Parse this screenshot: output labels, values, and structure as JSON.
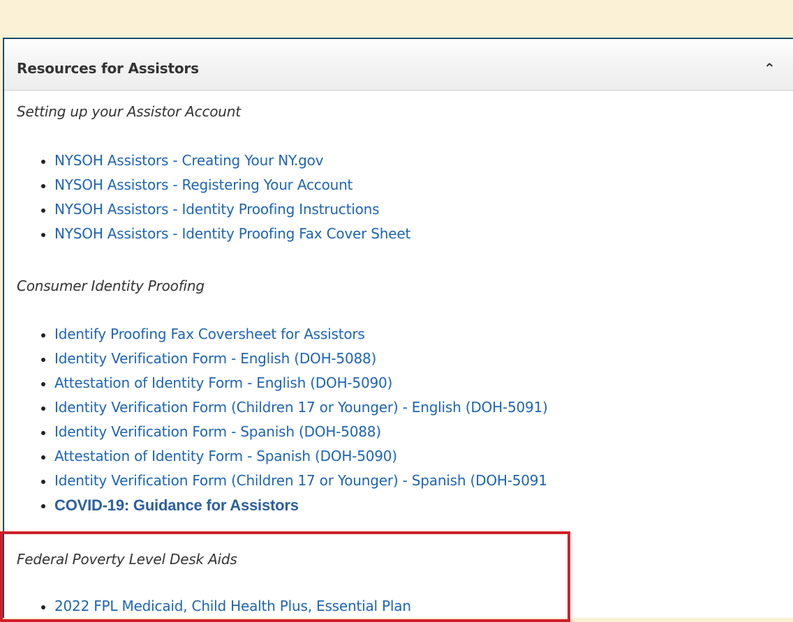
{
  "panel": {
    "title": "Resources for Assistors",
    "collapse_icon": "chevron-up-icon"
  },
  "sections": [
    {
      "title": "Setting up your Assistor Account",
      "links": [
        "NYSOH Assistors - Creating Your NY.gov",
        "NYSOH Assistors - Registering Your Account",
        "NYSOH Assistors - Identity Proofing Instructions",
        "NYSOH Assistors - Identity Proofing Fax Cover Sheet"
      ]
    },
    {
      "title": "Consumer Identity Proofing",
      "links": [
        "Identify Proofing Fax Coversheet for Assistors",
        "Identity Verification Form - English (DOH-5088)",
        "Attestation of Identity Form - English (DOH-5090)",
        "Identity Verification Form (Children 17 or Younger) - English (DOH-5091)",
        "Identity Verification Form - Spanish (DOH-5088)",
        "Attestation of Identity Form - Spanish (DOH-5090)",
        "Identity Verification Form (Children 17 or Younger) - Spanish (DOH-5091",
        "COVID-19: Guidance for Assistors"
      ]
    },
    {
      "title": "Federal Poverty Level Desk Aids",
      "links": [
        "2022 FPL Medicaid, Child Health Plus, Essential Plan"
      ]
    }
  ],
  "colors": {
    "page_background": "#fbf1d6",
    "link": "#1e64b4",
    "highlight_border": "#d0202a",
    "panel_border": "#1a4a6e"
  }
}
